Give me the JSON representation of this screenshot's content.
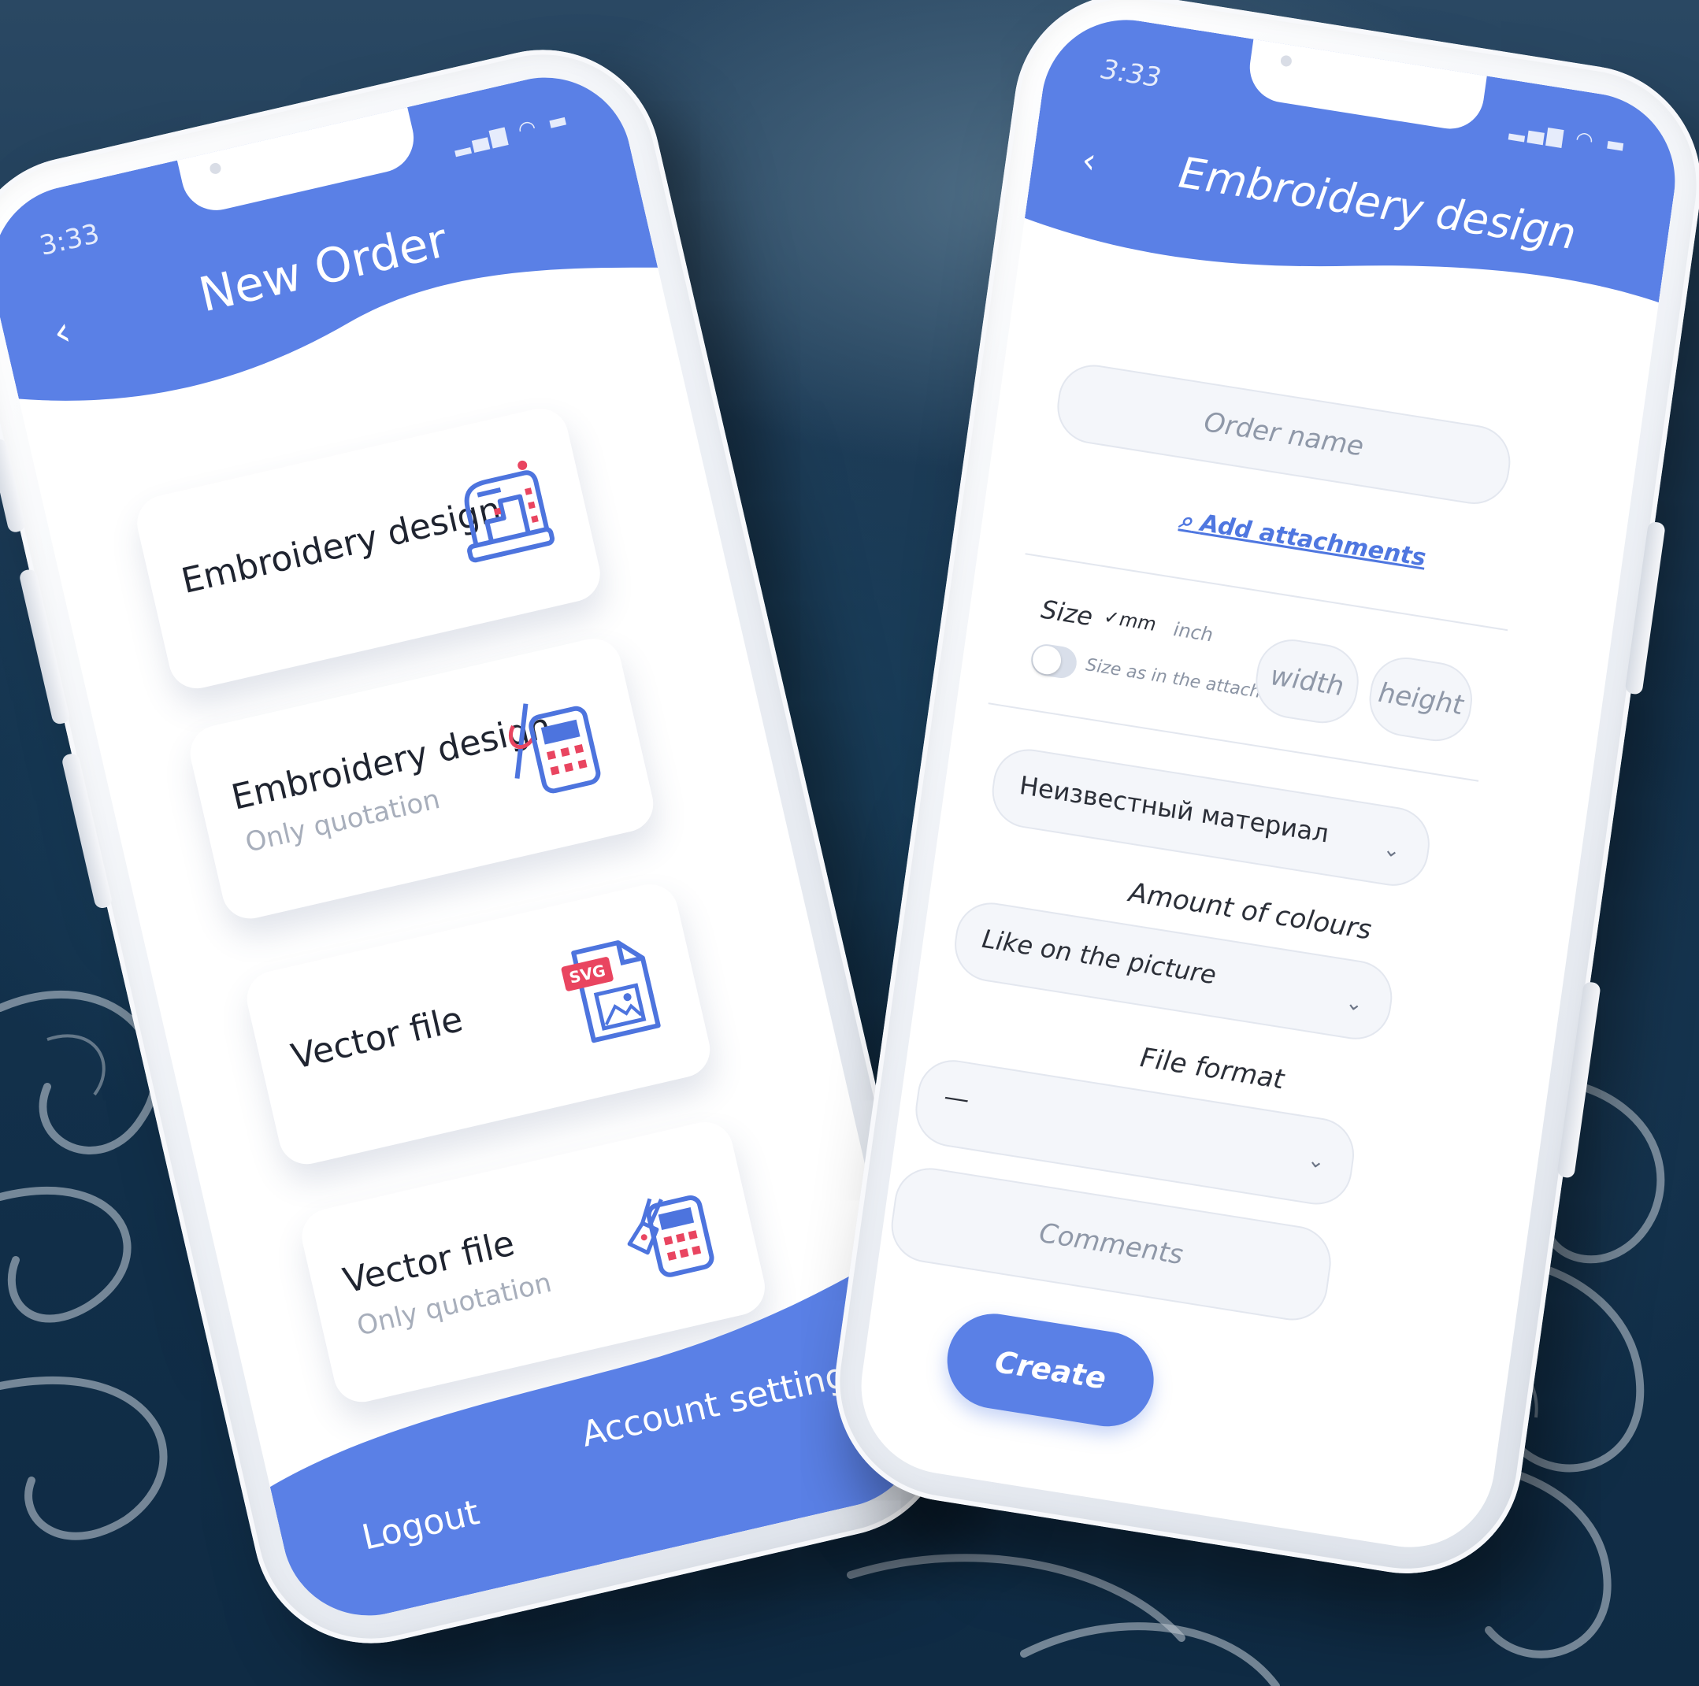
{
  "colors": {
    "accent": "#5a80e6",
    "accent_dark": "#4f77e0",
    "icon_blue": "#4d74de",
    "icon_red": "#e94560",
    "background": "#13324d"
  },
  "left_phone": {
    "status": {
      "time": "3:33",
      "icons": "signal wifi battery"
    },
    "header": {
      "back": "‹",
      "title": "New Order"
    },
    "cards": [
      {
        "title": "Embroidery design",
        "subtitle": "",
        "icon": "sewing-machine-icon"
      },
      {
        "title": "Embroidery design",
        "subtitle": "Only quotation",
        "icon": "needle-calculator-icon"
      },
      {
        "title": "Vector file",
        "subtitle": "",
        "icon": "svg-file-icon"
      },
      {
        "title": "Vector file",
        "subtitle": "Only quotation",
        "icon": "pen-calculator-icon"
      }
    ],
    "footer": {
      "logout": "Logout",
      "account_settings": "Account settings"
    }
  },
  "right_phone": {
    "status": {
      "time": "3:33",
      "icons": "signal wifi battery"
    },
    "header": {
      "back": "‹",
      "title": "Embroidery design"
    },
    "form": {
      "order_name_placeholder": "Order name",
      "add_attachments": "Add attachments",
      "size_label": "Size",
      "unit_mm": "mm",
      "unit_inch": "inch",
      "size_toggle_label": "Size as in the attachment",
      "width_placeholder": "width",
      "height_placeholder": "height",
      "material_value": "Неизвестный материал",
      "colours_label": "Amount of colours",
      "colours_value": "Like on the picture",
      "format_label": "File format",
      "format_value": "—",
      "comments_placeholder": "Comments",
      "create_label": "Create"
    }
  }
}
